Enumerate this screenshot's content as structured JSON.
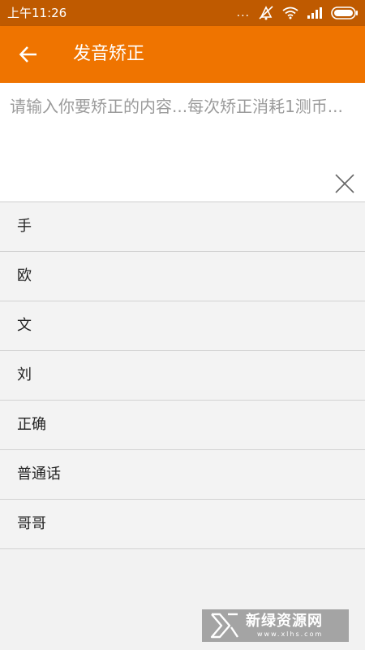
{
  "status_bar": {
    "time": "上午11:26",
    "dots": "...",
    "icons": [
      "mute-icon",
      "wifi-icon",
      "signal-icon",
      "battery-icon"
    ]
  },
  "app_bar": {
    "title": "发音矫正",
    "back_icon": "back-arrow-icon",
    "color": "#ef7400"
  },
  "input": {
    "value": "",
    "placeholder": "请输入你要矫正的内容...每次矫正消耗1测币...",
    "clear_icon": "close-icon"
  },
  "history": {
    "items": [
      {
        "label": "手"
      },
      {
        "label": "欧"
      },
      {
        "label": "文"
      },
      {
        "label": "刘"
      },
      {
        "label": "正确"
      },
      {
        "label": "普通话"
      },
      {
        "label": "哥哥"
      }
    ]
  },
  "watermark": {
    "text": "新绿资源网",
    "url": "www.xlhs.com"
  },
  "colors": {
    "status_bar": "#bf5a00",
    "app_bar": "#ef7400",
    "background": "#f2f2f2"
  }
}
